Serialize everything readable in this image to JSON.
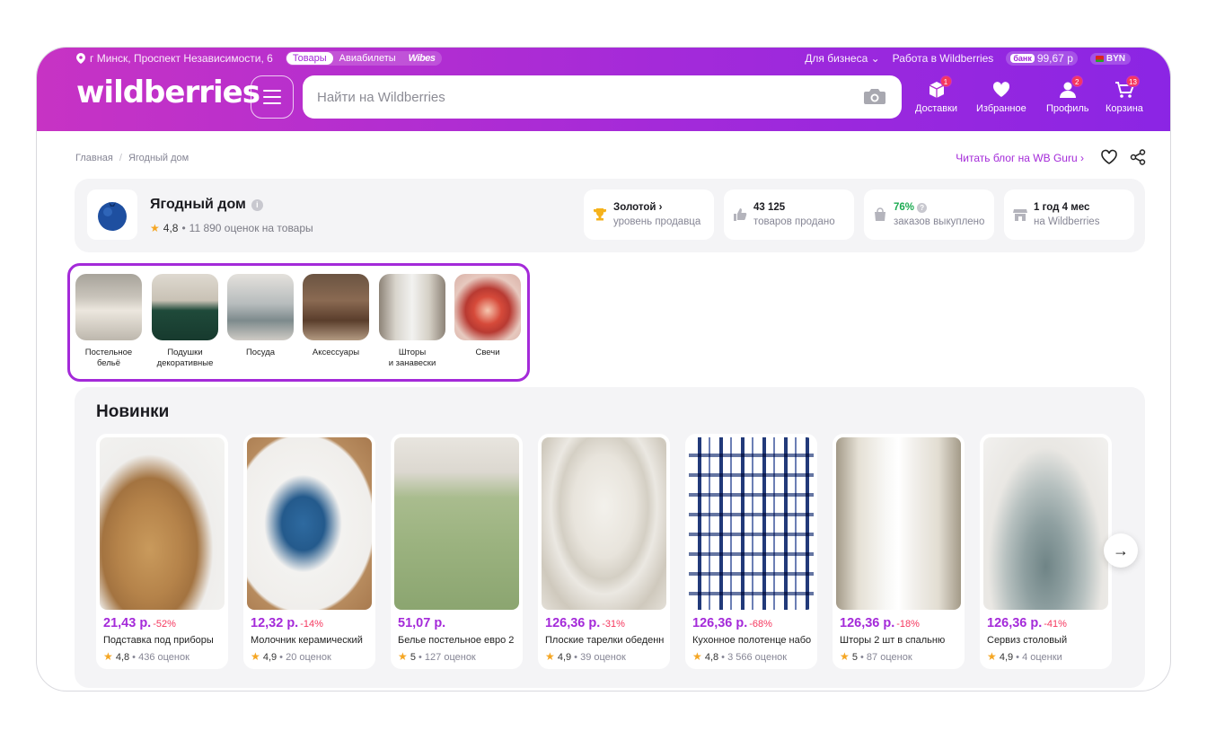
{
  "header": {
    "location": "г Минск, Проспект Независимости, 6",
    "tabs": [
      "Товары",
      "Авиабилеты",
      "Wibes"
    ],
    "business": "Для бизнеса",
    "jobs": "Работа в Wildberries",
    "bank_tag": "банк",
    "bank_balance": "99,67 р",
    "currency": "BYN",
    "logo": "wildberries",
    "search_placeholder": "Найти на Wildberries",
    "nav": [
      {
        "label": "Доставки",
        "badge": "1",
        "icon": "delivery-box-icon"
      },
      {
        "label": "Избранное",
        "badge": "",
        "icon": "heart-icon"
      },
      {
        "label": "Профиль",
        "badge": "2",
        "icon": "profile-icon"
      },
      {
        "label": "Корзина",
        "badge": "13",
        "icon": "cart-icon"
      }
    ],
    "colors": {
      "accent": "#a42ad9",
      "accent_start": "#c733c4",
      "badge": "#f5385f",
      "discount": "#f5385f",
      "green": "#1dab52"
    }
  },
  "breadcrumbs": [
    "Главная",
    "Ягодный дом"
  ],
  "blog_link": "Читать блог на WB Guru",
  "seller": {
    "name": "Ягодный дом",
    "rating": "4,8",
    "reviews": "11 890 оценок на товары",
    "stats": [
      {
        "value": "Золотой",
        "label": "уровень продавца",
        "icon": "trophy-icon"
      },
      {
        "value": "43 125",
        "label": "товаров продано",
        "icon": "thumbs-up-icon"
      },
      {
        "value": "76%",
        "label": "заказов выкуплено",
        "icon": "bag-icon"
      },
      {
        "value": "1 год 4 мес",
        "label": "на Wildberries",
        "icon": "shop-icon"
      }
    ]
  },
  "categories": [
    {
      "label": "Постельное\nбельё"
    },
    {
      "label": "Подушки\nдекоративные"
    },
    {
      "label": "Посуда"
    },
    {
      "label": "Аксессуары"
    },
    {
      "label": "Шторы\nи занавески"
    },
    {
      "label": "Свечи"
    }
  ],
  "news": {
    "title": "Новинки",
    "products": [
      {
        "price": "21,43 р.",
        "discount": "-52%",
        "name": "Подставка под приборы",
        "rating": "4,8",
        "reviews": "436 оценок"
      },
      {
        "price": "12,32 р.",
        "discount": "-14%",
        "name": "Молочник керамический",
        "rating": "4,9",
        "reviews": "20 оценок"
      },
      {
        "price": "51,07 р.",
        "discount": "",
        "name": "Белье постельное евро 2",
        "rating": "5",
        "reviews": "127 оценок"
      },
      {
        "price": "126,36 р.",
        "discount": "-31%",
        "name": "Плоские тарелки обеденные",
        "rating": "4,9",
        "reviews": "39 оценок"
      },
      {
        "price": "126,36 р.",
        "discount": "-68%",
        "name": "Кухонное полотенце набор",
        "rating": "4,8",
        "reviews": "3 566 оценок"
      },
      {
        "price": "126,36 р.",
        "discount": "-18%",
        "name": "Шторы 2 шт в спальню",
        "rating": "5",
        "reviews": "87 оценок"
      },
      {
        "price": "126,36 р.",
        "discount": "-41%",
        "name": "Сервиз столовый",
        "rating": "4,9",
        "reviews": "4 оценки"
      }
    ]
  }
}
